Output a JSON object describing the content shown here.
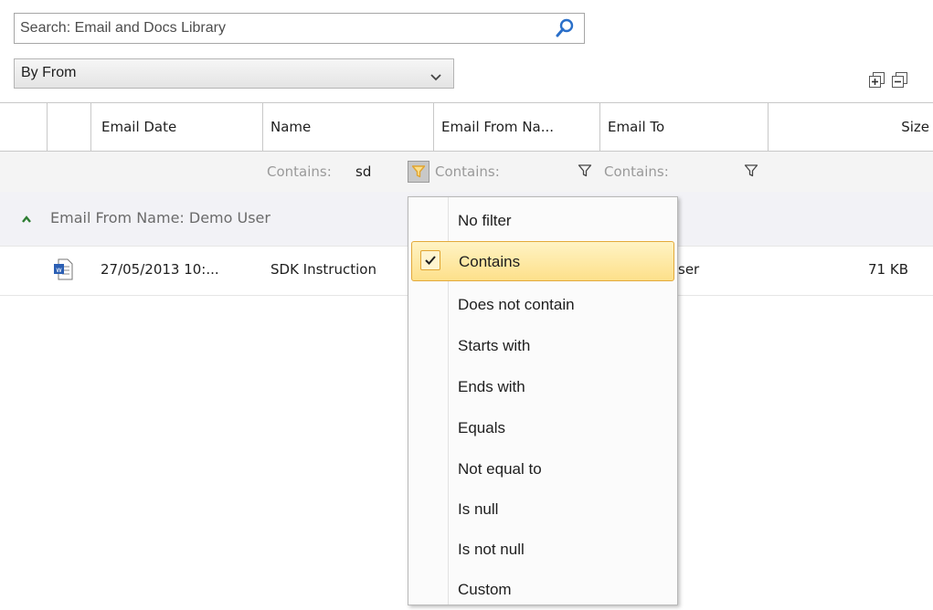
{
  "search": {
    "placeholder": "Search: Email and Docs Library",
    "icon": "search-icon"
  },
  "group_by": {
    "selected": "By From"
  },
  "toolbar": {
    "expand_icon": "expand-all-icon",
    "collapse_icon": "collapse-all-icon"
  },
  "grid": {
    "columns": [
      "",
      "",
      "Email Date",
      "Name",
      "Email From Na...",
      "Email To",
      "Size"
    ],
    "filters": {
      "name_prefix": "Contains:",
      "name_value": "sd",
      "email_from_prefix": "Contains:",
      "email_to_prefix": "Contains:"
    },
    "group": {
      "label": "Email From Name: Demo User"
    },
    "rows": [
      {
        "icon": "word-document-icon",
        "email_date": "27/05/2013 10:...",
        "name": "SDK Instruction",
        "email_to": "ser",
        "size": "71 KB"
      }
    ]
  },
  "filter_menu": {
    "items": [
      "No filter",
      "Contains",
      "Does not contain",
      "Starts with",
      "Ends with",
      "Equals",
      "Not equal to",
      "Is null",
      "Is not null",
      "Custom"
    ],
    "selected": "Contains"
  },
  "colors": {
    "accent_border": "#e3a93a",
    "selected_bg": "#fde08a",
    "filter_icon": "#e0a431",
    "group_caret": "#2e7d32",
    "search_icon": "#2a6fc9"
  }
}
